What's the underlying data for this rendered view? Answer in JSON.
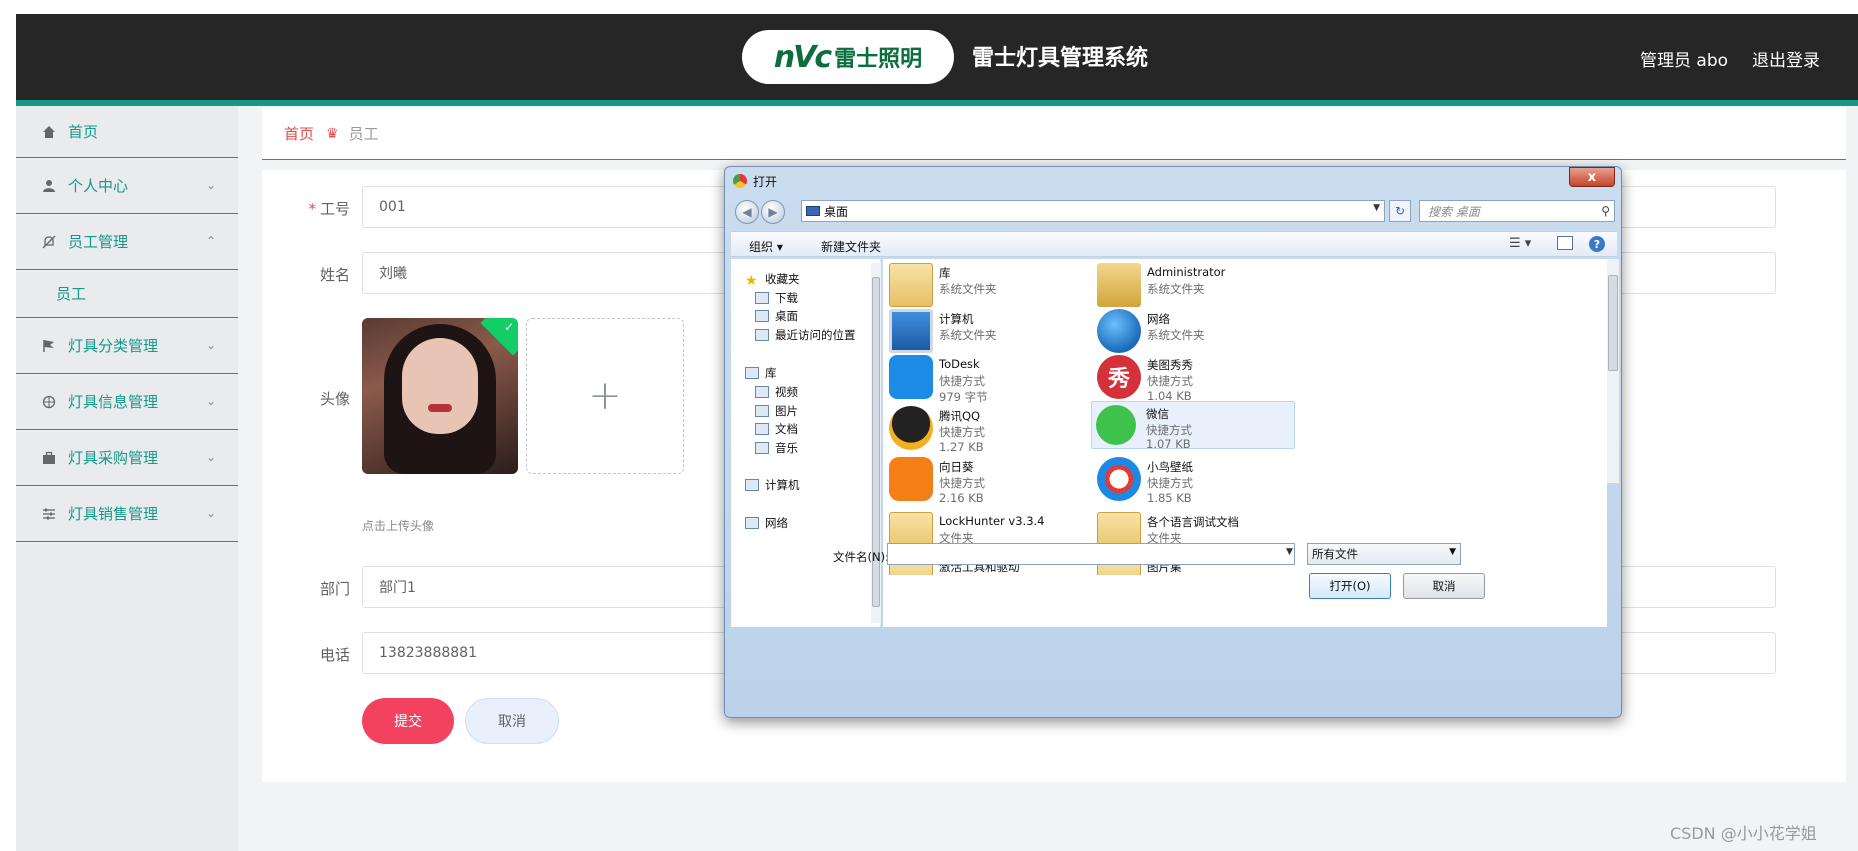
{
  "header": {
    "logo_mark": "nVc",
    "logo_text": "雷士照明",
    "title": "雷士灯具管理系统",
    "user": "管理员 abo",
    "logout": "退出登录"
  },
  "sidebar": {
    "items": [
      {
        "label": "首页",
        "icon": "home-icon"
      },
      {
        "label": "个人中心",
        "icon": "user-icon"
      },
      {
        "label": "员工管理",
        "icon": "bell-off-icon"
      },
      {
        "label": "员工",
        "sub": true
      },
      {
        "label": "灯具分类管理",
        "icon": "flag-icon"
      },
      {
        "label": "灯具信息管理",
        "icon": "target-icon"
      },
      {
        "label": "灯具采购管理",
        "icon": "briefcase-icon"
      },
      {
        "label": "灯具销售管理",
        "icon": "sliders-icon"
      }
    ]
  },
  "breadcrumb": {
    "home": "首页",
    "current": "员工"
  },
  "form": {
    "id_label": "工号",
    "id_value": "001",
    "name_label": "姓名",
    "name_value": "刘曦",
    "avatar_label": "头像",
    "upload_tip": "点击上传头像",
    "dept_label": "部门",
    "dept_value": "部门1",
    "phone_label": "电话",
    "phone_value": "13823888881",
    "submit": "提交",
    "cancel": "取消"
  },
  "dialog": {
    "title": "打开",
    "close": "x",
    "address": "桌面",
    "search_placeholder": "搜索 桌面",
    "organize": "组织 ▾",
    "new_folder": "新建文件夹",
    "nav": [
      {
        "label": "收藏夹",
        "group": true
      },
      {
        "label": "下载"
      },
      {
        "label": "桌面"
      },
      {
        "label": "最近访问的位置"
      },
      {
        "label": "库",
        "group": true
      },
      {
        "label": "视频"
      },
      {
        "label": "图片"
      },
      {
        "label": "文档"
      },
      {
        "label": "音乐"
      },
      {
        "label": "计算机",
        "group": true
      },
      {
        "label": "网络",
        "group": true
      }
    ],
    "files": [
      {
        "name": "库",
        "type": "系统文件夹",
        "size": "",
        "icon": "folder-icon"
      },
      {
        "name": "Administrator",
        "type": "系统文件夹",
        "size": "",
        "icon": "user-folder-icon"
      },
      {
        "name": "计算机",
        "type": "系统文件夹",
        "size": "",
        "icon": "computer-icon"
      },
      {
        "name": "网络",
        "type": "系统文件夹",
        "size": "",
        "icon": "network-icon"
      },
      {
        "name": "ToDesk",
        "type": "快捷方式",
        "size": "979 字节",
        "icon": "todesk-icon"
      },
      {
        "name": "美图秀秀",
        "type": "快捷方式",
        "size": "1.04 KB",
        "icon": "meitu-icon"
      },
      {
        "name": "腾讯QQ",
        "type": "快捷方式",
        "size": "1.27 KB",
        "icon": "qq-icon"
      },
      {
        "name": "微信",
        "type": "快捷方式",
        "size": "1.07 KB",
        "icon": "wechat-icon"
      },
      {
        "name": "向日葵",
        "type": "快捷方式",
        "size": "2.16 KB",
        "icon": "sunlogin-icon"
      },
      {
        "name": "小鸟壁纸",
        "type": "快捷方式",
        "size": "1.85 KB",
        "icon": "bird-icon"
      },
      {
        "name": "LockHunter v3.3.4",
        "type": "文件夹",
        "size": "",
        "icon": "folder-icon"
      },
      {
        "name": "各个语言调试文档",
        "type": "文件夹",
        "size": "",
        "icon": "folder-icon"
      },
      {
        "name": "激活工具和驱动",
        "type": "",
        "size": "",
        "icon": "folder-icon"
      },
      {
        "name": "图片集",
        "type": "",
        "size": "",
        "icon": "folder-icon"
      }
    ],
    "filename_label": "文件名(N):",
    "filename_value": "",
    "filetype": "所有文件",
    "open": "打开(O)",
    "cancel": "取消"
  },
  "watermark": "CSDN @小小花学姐"
}
